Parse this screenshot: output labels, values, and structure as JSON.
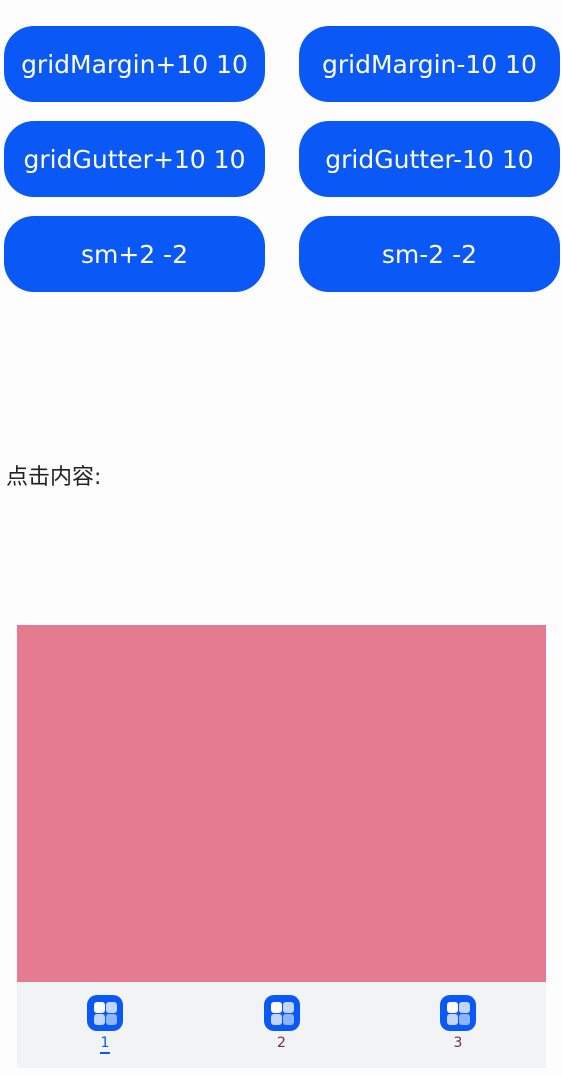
{
  "buttons": [
    {
      "label": "gridMargin+10 10"
    },
    {
      "label": "gridMargin-10 10"
    },
    {
      "label": "gridGutter+10 10"
    },
    {
      "label": "gridGutter-10 10"
    },
    {
      "label": "sm+2 -2"
    },
    {
      "label": "sm-2 -2"
    }
  ],
  "click_content_label": "点击内容:",
  "content": {
    "color": "#e57b91"
  },
  "tabbar": {
    "active_index": 0,
    "tabs": [
      {
        "label": "1",
        "icon": "grid-app-icon"
      },
      {
        "label": "2",
        "icon": "grid-app-icon"
      },
      {
        "label": "3",
        "icon": "grid-app-icon"
      }
    ]
  },
  "colors": {
    "accent": "#0a59f7",
    "tabbar_bg": "#f1f3f5",
    "inactive_tab_label": "#7a2a3a"
  }
}
